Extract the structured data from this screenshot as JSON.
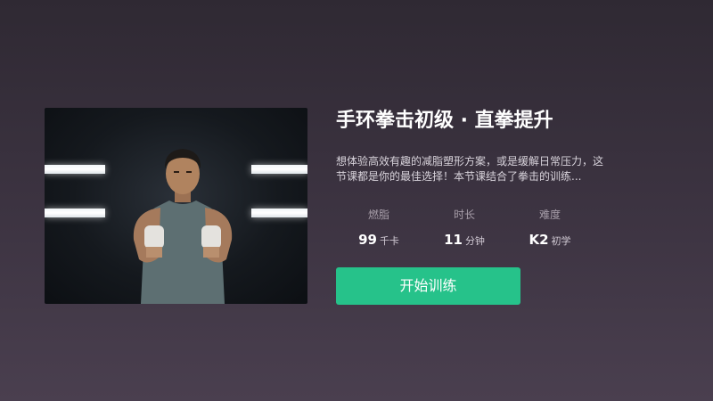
{
  "course": {
    "title": "手环拳击初级 · 直拳提升",
    "description": "想体验高效有趣的减脂塑形方案，或是缓解日常压力，这节课都是你的最佳选择！本节课结合了拳击的训练..."
  },
  "stats": [
    {
      "label": "燃脂",
      "value": "99",
      "unit": "千卡"
    },
    {
      "label": "时长",
      "value": "11",
      "unit": "分钟"
    },
    {
      "label": "难度",
      "value": "K2",
      "unit": "初学"
    }
  ],
  "actions": {
    "start_label": "开始训练"
  },
  "colors": {
    "accent": "#26c28a",
    "background": "#3d3442"
  }
}
